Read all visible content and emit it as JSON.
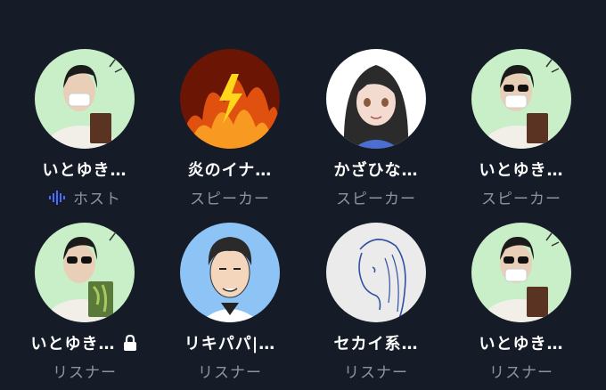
{
  "participants": [
    {
      "name": "いとゆき…",
      "role": "ホスト",
      "icon": "avatar-woman-mask-book",
      "speaking_icon": "audio-wave-icon",
      "bg": "#c9efc9"
    },
    {
      "name": "炎のイナ…",
      "role": "スピーカー",
      "icon": "avatar-fire-lightning",
      "bg": "#7a1a05"
    },
    {
      "name": "かざひな…",
      "role": "スピーカー",
      "icon": "avatar-anime-girl",
      "bg": "#ffffff"
    },
    {
      "name": "いとゆき…",
      "role": "スピーカー",
      "icon": "avatar-woman-mask-sunglasses",
      "bg": "#c9efc9"
    },
    {
      "name": "いとゆき…",
      "role": "リスナー",
      "icon": "avatar-woman-sunglasses-plant",
      "locked": true,
      "bg": "#c9efc9"
    },
    {
      "name": "リキパパ|…",
      "role": "リスナー",
      "icon": "avatar-man-illustration",
      "bg": "#8ec3f5"
    },
    {
      "name": "セカイ系…",
      "role": "リスナー",
      "icon": "avatar-line-drawing",
      "bg": "#ebebeb"
    },
    {
      "name": "いとゆき…",
      "role": "リスナー",
      "icon": "avatar-woman-sunglasses-book",
      "bg": "#c9efc9"
    }
  ],
  "colors": {
    "background": "#151c28",
    "host_accent": "#4a6cff",
    "muted_text": "#8b94a3"
  }
}
